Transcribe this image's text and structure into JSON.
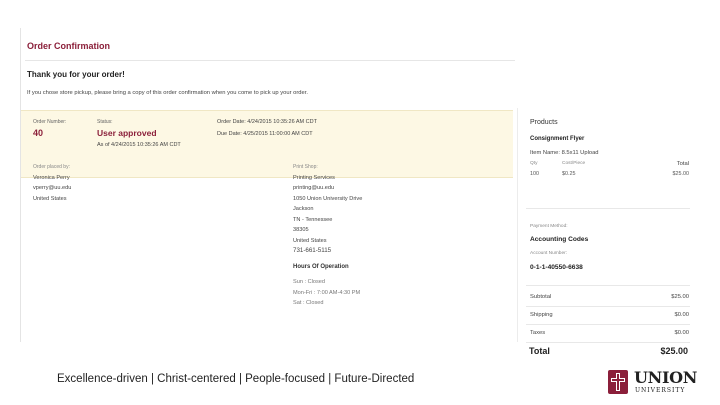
{
  "header": {
    "title": "Order Confirmation",
    "thanks": "Thank you for your order!",
    "notice": "If you chose store pickup, please bring a copy of this order confirmation when you come to pick up your order."
  },
  "summary": {
    "order_number_label": "Order Number:",
    "order_number": "40",
    "status_label": "Status:",
    "status": "User approved",
    "status_as_of": "As of 4/24/2015 10:35:26 AM CDT",
    "order_date": "Order Date: 4/24/2015 10:35:26 AM CDT",
    "due_date": "Due Date: 4/25/2015 11:00:00 AM CDT"
  },
  "placed_by": {
    "label": "Order placed by:",
    "name": "Veronica Perry",
    "email": "vperry@uu.edu",
    "country": "United States"
  },
  "print_shop": {
    "label": "Print Shop:",
    "name": "Printing Services",
    "email": "printing@uu.edu",
    "address": "1050 Union University Drive",
    "city": "Jackson",
    "state": "TN - Tennessee",
    "zip": "38305",
    "country": "United States",
    "phone": "731-661-5115",
    "hours_title": "Hours Of Operation",
    "hours": [
      "Sun : Closed",
      "Mon-Fri : 7:00 AM-4:30 PM",
      "Sat : Closed"
    ]
  },
  "products": {
    "header": "Products",
    "consignment": "Consignment Flyer",
    "item_name": "Item Name: 8.5x11 Upload",
    "col_qty": "Qty",
    "col_cost": "Cost/Piece",
    "col_total": "Total",
    "qty": "100",
    "cost": "$0.25",
    "total": "$25.00",
    "payment_label": "Payment Method:",
    "payment_method": "Accounting Codes",
    "account_label": "Account Number:",
    "account_number": "0-1-1-40550-6638",
    "subtotal_label": "Subtotal",
    "subtotal": "$25.00",
    "shipping_label": "Shipping",
    "shipping": "$0.00",
    "taxes_label": "Taxes",
    "taxes": "$0.00",
    "grand_total_label": "Total",
    "grand_total": "$25.00"
  },
  "footer": {
    "tagline": "Excellence-driven  |  Christ-centered  |  People-focused  |  Future-Directed",
    "logo_word": "UNION",
    "logo_sub": "UNIVERSITY",
    "brand_color": "#8b1f3a"
  }
}
